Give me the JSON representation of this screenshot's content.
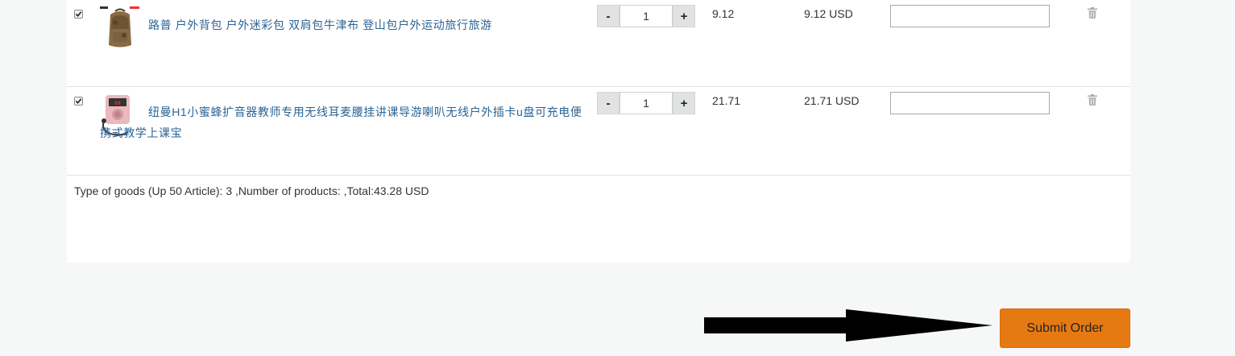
{
  "cart": {
    "items": [
      {
        "checked": true,
        "name": "路普 户外背包 户外迷彩包 双肩包牛津布 登山包户外运动旅行旅游",
        "quantity": "1",
        "minus_label": "-",
        "plus_label": "+",
        "price": "9.12",
        "subtotal": "9.12 USD",
        "remark": "",
        "thumbnail_icon": "camouflage-backpack-icon"
      },
      {
        "checked": true,
        "name": "纽曼H1小蜜蜂扩音器教师专用无线耳麦腰挂讲课导游喇叭无线户外插卡u盘可充电便携式教学上课宝",
        "quantity": "1",
        "minus_label": "-",
        "plus_label": "+",
        "price": "21.71",
        "subtotal": "21.71 USD",
        "remark": "",
        "thumbnail_icon": "pink-voice-amplifier-icon"
      }
    ],
    "summary": "Type of goods (Up 50 Article): 3 ,Number of products: ,Total:43.28 USD"
  },
  "actions": {
    "submit_label": "Submit Order",
    "submit_color": "#e67a12"
  },
  "colors": {
    "link": "#2a6496",
    "page_bg": "#f6f7f7",
    "panel_bg": "#ffffff"
  }
}
